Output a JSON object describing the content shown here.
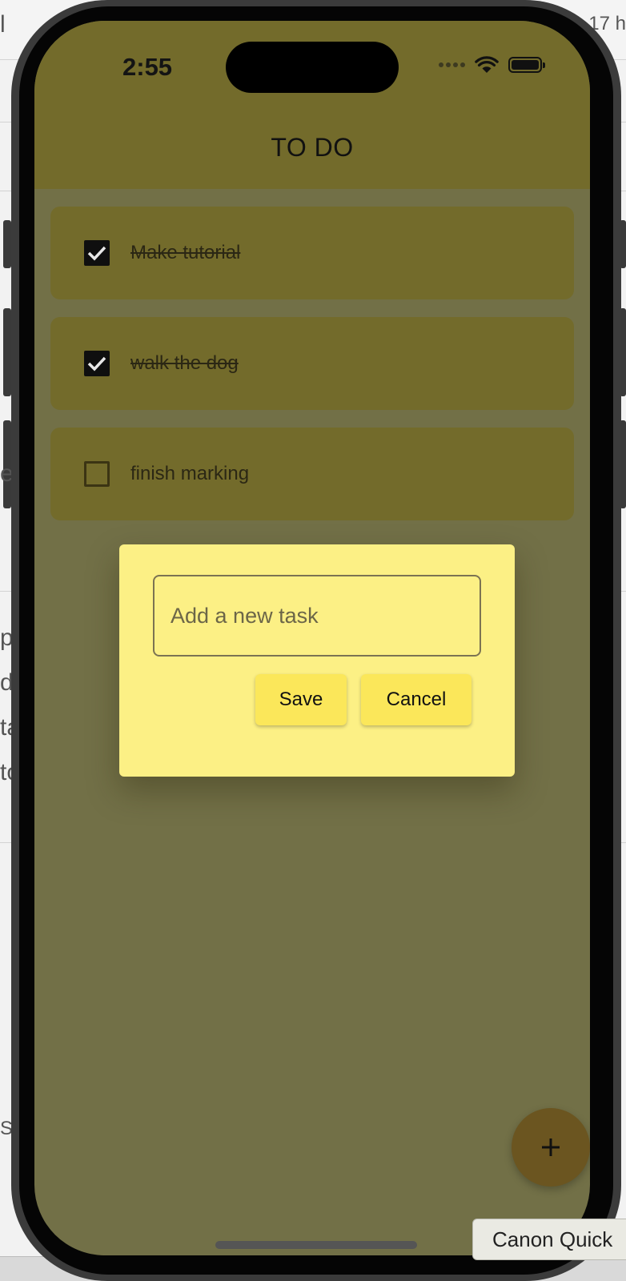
{
  "background_window": {
    "top_right_text": "17 h",
    "left_fragments": [
      "l",
      "e",
      "p",
      "d",
      "ta",
      "to",
      "Se"
    ]
  },
  "status_bar": {
    "time": "2:55",
    "icons": [
      "cellular-dots-icon",
      "wifi-icon",
      "battery-icon"
    ]
  },
  "app": {
    "title": "TO DO",
    "tasks": [
      {
        "label": "Make tutorial",
        "done": true
      },
      {
        "label": "walk the dog",
        "done": true
      },
      {
        "label": "finish marking",
        "done": false
      }
    ]
  },
  "dialog": {
    "input_placeholder": "Add a new task",
    "input_value": "",
    "save_label": "Save",
    "cancel_label": "Cancel"
  },
  "fab": {
    "icon": "plus-icon"
  },
  "tooltip": {
    "text": "Canon Quick"
  },
  "colors": {
    "appbar": "#736b2b",
    "scrim": "#727047",
    "dialog_bg": "#fcf085",
    "button_bg": "#fbe75a",
    "fab_bg": "#6b5520"
  }
}
